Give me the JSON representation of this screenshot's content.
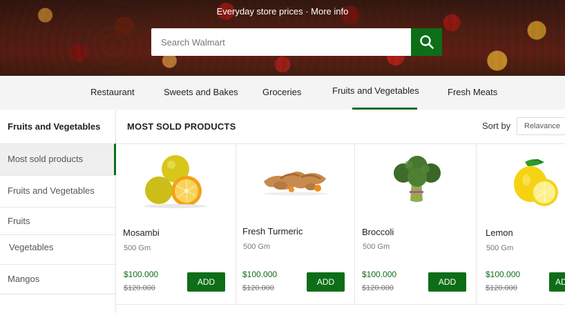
{
  "hero": {
    "tagline": "Everyday store prices · More info"
  },
  "search": {
    "placeholder": "Search Walmart",
    "button_icon": "search-icon"
  },
  "categories": [
    {
      "label": "Restaurant",
      "active": false
    },
    {
      "label": "Sweets and Bakes",
      "active": false
    },
    {
      "label": "Groceries",
      "active": false
    },
    {
      "label": "Fruits and Vegetables",
      "active": true
    },
    {
      "label": "Fresh Meats",
      "active": false
    }
  ],
  "sidebar": {
    "title": "Fruits and Vegetables",
    "items": [
      {
        "label": "Most sold products",
        "active": true
      },
      {
        "label": "Fruits and Vegetables",
        "active": false
      },
      {
        "label": "Fruits",
        "active": false
      },
      {
        "label": "Vegetables",
        "active": false
      },
      {
        "label": "Mangos",
        "active": false
      }
    ]
  },
  "main": {
    "title": "MOST SOLD PRODUCTS",
    "sort_label": "Sort by",
    "sort_value": "Relavance"
  },
  "products": [
    {
      "name": "Mosambi",
      "weight": "500 Gm",
      "price": "$100.000",
      "old_price": "$120.000",
      "add_label": "ADD",
      "image_icon": "mosambi-image"
    },
    {
      "name": "Fresh Turmeric",
      "weight": "500 Gm",
      "price": "$100.000",
      "old_price": "$120.000",
      "add_label": "ADD",
      "image_icon": "turmeric-image"
    },
    {
      "name": "Broccoli",
      "weight": "500 Gm",
      "price": "$100.000",
      "old_price": "$120.000",
      "add_label": "ADD",
      "image_icon": "broccoli-image"
    },
    {
      "name": "Lemon",
      "weight": "500 Gm",
      "price": "$100.000",
      "old_price": "$120.000",
      "add_label": "ADD",
      "image_icon": "lemon-image"
    }
  ],
  "colors": {
    "accent": "#0d6e17",
    "nav_bg": "#f4f4f4",
    "price": "#0d6e17"
  }
}
